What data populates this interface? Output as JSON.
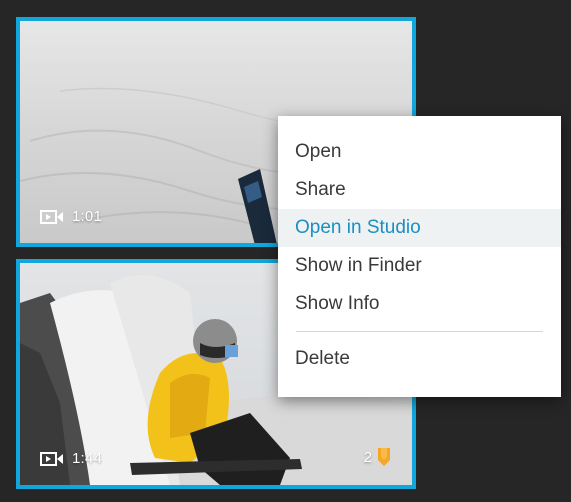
{
  "thumbnails": [
    {
      "duration": "1:01",
      "duration_icon": "video-camera-icon",
      "selected": true
    },
    {
      "duration": "1:44",
      "duration_icon": "video-camera-icon",
      "hilight_count": "2",
      "hilight_icon": "hilight-tag-icon",
      "selected": true
    }
  ],
  "context_menu": {
    "items": [
      {
        "label": "Open"
      },
      {
        "label": "Share"
      },
      {
        "label": "Open in Studio",
        "active": true
      },
      {
        "label": "Show in Finder"
      },
      {
        "label": "Show Info"
      },
      {
        "label": "Delete"
      }
    ]
  },
  "colors": {
    "background": "#262626",
    "selection_border": "#12a7dc",
    "menu_active_text": "#1b8fc4",
    "menu_active_bg": "#eff2f2",
    "hilight_tag": "#f5a623"
  }
}
